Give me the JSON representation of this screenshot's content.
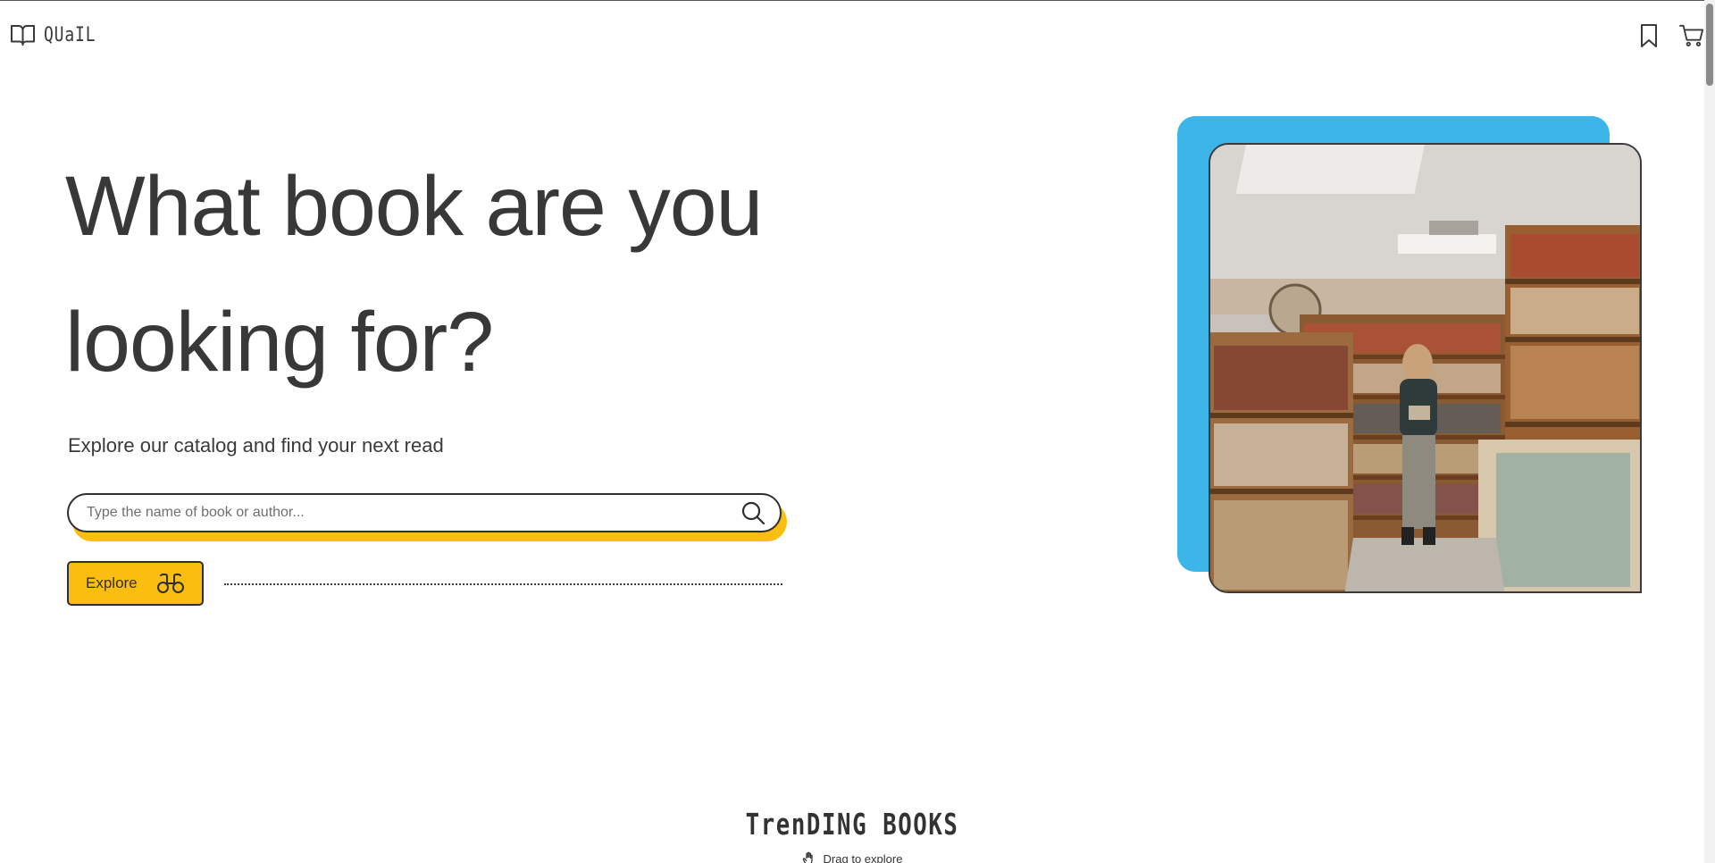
{
  "header": {
    "brand_name": "QUaIL",
    "icons": [
      "book-open-icon",
      "bookmark-icon",
      "cart-icon"
    ]
  },
  "hero": {
    "title": "What book are you looking for?",
    "subtitle": "Explore our catalog and find your next read",
    "search": {
      "placeholder": "Type the name of book or author...",
      "value": ""
    },
    "explore_label": "Explore"
  },
  "trending": {
    "title": "TrenDING BOOKS",
    "drag_hint": "Drag to explore"
  },
  "colors": {
    "accent_yellow": "#fbbd0f",
    "accent_blue": "#3cb5e8",
    "text_dark": "#383838"
  }
}
